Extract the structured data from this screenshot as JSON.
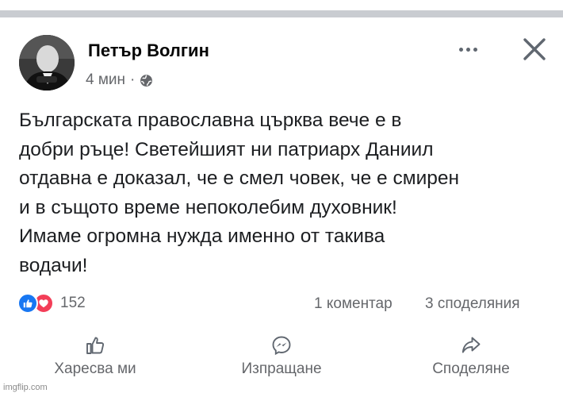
{
  "post": {
    "author": "Петър Волгин",
    "time": "4 мин",
    "separator": "·",
    "text_lines": [
      "Българската православна църква вече е в",
      "добри ръце! Светейшият ни патриарх Даниил",
      "отдавна е доказал, че е смел човек, че е смирен",
      "и в същото време непоколебим духовник!",
      "Имаме огромна нужда именно от такива",
      "водачи!"
    ],
    "reaction_count": "152",
    "comments": "1 коментар",
    "shares": "3 споделяния"
  },
  "actions": {
    "like": "Харесва ми",
    "send": "Изпращане",
    "share": "Споделяне"
  },
  "watermark": "imgflip.com",
  "colors": {
    "like_blue": "#1877f2",
    "love_red": "#f33e58",
    "secondary_text": "#65676b",
    "divider": "#c9ccd1"
  },
  "icons": {
    "audience": "globe-icon",
    "more": "more-dots-icon",
    "close": "close-icon",
    "like_reaction": "thumbs-up-icon",
    "love_reaction": "heart-icon",
    "like_action": "thumbs-up-outline-icon",
    "send_action": "messenger-icon",
    "share_action": "share-arrow-icon"
  }
}
